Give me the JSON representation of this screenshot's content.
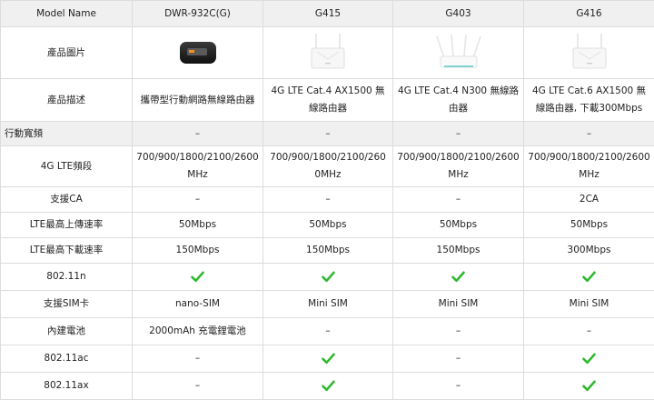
{
  "header": {
    "model_label": "Model Name",
    "products": [
      "DWR-932C(G)",
      "G415",
      "G403",
      "G416"
    ]
  },
  "image_row": {
    "label": "產品圖片",
    "images": [
      "pocket-router-photo",
      "router-g415-photo",
      "router-g403-photo",
      "router-g416-photo"
    ]
  },
  "desc_row": {
    "label": "產品描述",
    "values": [
      "攜帶型行動網路無線路由器",
      "4G LTE Cat.4 AX1500 無線路由器",
      "4G LTE Cat.4 N300 無線路由器",
      "4G LTE Cat.6 AX1500 無線路由器, 下載300Mbps"
    ]
  },
  "section": {
    "label": "行動寬頻",
    "values": [
      "–",
      "–",
      "–",
      "–"
    ]
  },
  "lte_row": {
    "label": "4G LTE頻段",
    "values": [
      "700/900/1800/2100/2600MHz",
      "700/900/1800/2100/2600MHz",
      "700/900/1800/2100/2600MHz",
      "700/900/1800/2100/2600MHz"
    ]
  },
  "ca_row": {
    "label": "支援CA",
    "values": [
      "–",
      "–",
      "–",
      "2CA"
    ]
  },
  "upload_row": {
    "label": "LTE最高上傳速率",
    "values": [
      "50Mbps",
      "50Mbps",
      "50Mbps",
      "50Mbps"
    ]
  },
  "download_row": {
    "label": "LTE最高下載速率",
    "values": [
      "150Mbps",
      "150Mbps",
      "150Mbps",
      "300Mbps"
    ]
  },
  "n_row": {
    "label": "802.11n",
    "values": [
      true,
      true,
      true,
      true
    ]
  },
  "sim_row": {
    "label": "支援SIM卡",
    "values": [
      "nano-SIM",
      "Mini SIM",
      "Mini SIM",
      "Mini SIM"
    ]
  },
  "battery_row": {
    "label": "內建電池",
    "values": [
      "2000mAh 充電鋰電池",
      "–",
      "–",
      "–"
    ]
  },
  "ac_row": {
    "label": "802.11ac",
    "values": [
      false,
      true,
      false,
      true
    ]
  },
  "ax_row": {
    "label": "802.11ax",
    "values": [
      false,
      true,
      false,
      true
    ]
  },
  "colors": {
    "header_bg": "#f0f0f0",
    "border": "#dcdcdc",
    "check_green": "#2eb82e"
  },
  "icons": {
    "check": "check-icon",
    "dash": "–"
  }
}
